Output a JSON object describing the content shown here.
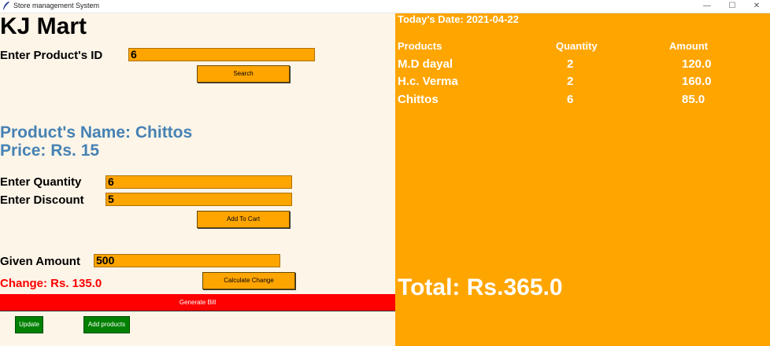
{
  "window": {
    "title": "Store management System",
    "minimize": "—",
    "maximize": "☐",
    "close": "✕"
  },
  "store": {
    "name": "KJ Mart"
  },
  "search": {
    "label": "Enter Product's ID",
    "value": "6",
    "button": "Search"
  },
  "product": {
    "name_text": "Product's Name: Chittos",
    "price_text": "Price: Rs. 15"
  },
  "quantity": {
    "label": "Enter Quantity",
    "value": "6"
  },
  "discount": {
    "label": "Enter Discount",
    "value": "5"
  },
  "cart": {
    "add_button": "Add To Cart"
  },
  "payment": {
    "label": "Given Amount",
    "value": "500",
    "change_text": "Change: Rs. 135.0",
    "calc_button": "Calculate Change"
  },
  "actions": {
    "generate_bill": "Generate Bill",
    "update": "Update",
    "add_products": "Add products"
  },
  "bill": {
    "date_text": "Today's Date: 2021-04-22",
    "headers": [
      "Products",
      "Quantity",
      "Amount"
    ],
    "rows": [
      {
        "product": "M.D dayal",
        "quantity": "2",
        "amount": "120.0"
      },
      {
        "product": "H.c. Verma",
        "quantity": "2",
        "amount": "160.0"
      },
      {
        "product": "Chittos",
        "quantity": "6",
        "amount": "85.0"
      }
    ],
    "total_text": "Total: Rs.365.0"
  },
  "colors": {
    "left_bg": "#fdf5e8",
    "accent": "#ffa500",
    "product_blue": "#4682b4",
    "alert_red": "#ff0000",
    "action_green": "#008000"
  }
}
